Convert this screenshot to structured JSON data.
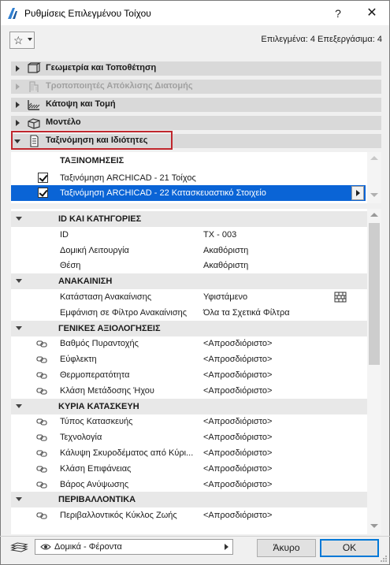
{
  "window": {
    "title": "Ρυθμίσεις Επιλεγμένου Τοίχου",
    "help": "?",
    "close": "✕"
  },
  "header": {
    "selection_info": "Επιλεγμένα: 4 Επεξεργάσιμα: 4"
  },
  "panels": [
    {
      "label": "Γεωμετρία και Τοποθέτηση",
      "enabled": true,
      "expanded": false,
      "icon": "geometry-icon"
    },
    {
      "label": "Τροποποιητές Απόκλισης Διατομής",
      "enabled": false,
      "expanded": false,
      "icon": "profile-modifier-icon"
    },
    {
      "label": "Κάτοψη και Τομή",
      "enabled": true,
      "expanded": false,
      "icon": "floor-plan-icon"
    },
    {
      "label": "Μοντέλο",
      "enabled": true,
      "expanded": false,
      "icon": "model-box-icon"
    },
    {
      "label": "Ταξινόμηση και Ιδιότητες",
      "enabled": true,
      "expanded": true,
      "icon": "document-icon"
    }
  ],
  "classifications": {
    "header": "ΤΑΞΙΝΟΜΗΣΕΙΣ",
    "items": [
      {
        "label": "Ταξινόμηση ARCHICAD - 21 Τοίχος",
        "checked": true,
        "selected": false
      },
      {
        "label": "Ταξινόμηση ARCHICAD - 22 Κατασκευαστικό Στοιχείο",
        "checked": true,
        "selected": true
      }
    ]
  },
  "properties": {
    "groups": [
      {
        "name": "ID ΚΑΙ ΚΑΤΗΓΟΡΙΕΣ",
        "rows": [
          {
            "name": "ID",
            "value": "ΤΧ - 003",
            "linked": false
          },
          {
            "name": "Δομική Λειτουργία",
            "value": "Ακαθόριστη",
            "linked": false
          },
          {
            "name": "Θέση",
            "value": "Ακαθόριστη",
            "linked": false
          }
        ]
      },
      {
        "name": "ΑΝΑΚΑΙΝΙΣΗ",
        "rows": [
          {
            "name": "Κατάσταση Ανακαίνισης",
            "value": "Υφιστάμενο",
            "linked": false,
            "icon": "brick-wall-icon"
          },
          {
            "name": "Εμφάνιση σε Φίλτρο Ανακαίνισης",
            "value": "Όλα τα Σχετικά Φίλτρα",
            "linked": false
          }
        ]
      },
      {
        "name": "ΓΕΝΙΚΕΣ ΑΞΙΟΛΟΓΗΣΕΙΣ",
        "rows": [
          {
            "name": "Βαθμός Πυραντοχής",
            "value": "<Απροσδιόριστο>",
            "linked": true
          },
          {
            "name": "Εύφλεκτη",
            "value": "<Απροσδιόριστο>",
            "linked": true
          },
          {
            "name": "Θερμοπερατότητα",
            "value": "<Απροσδιόριστο>",
            "linked": true
          },
          {
            "name": "Κλάση Μετάδοσης Ήχου",
            "value": "<Απροσδιόριστο>",
            "linked": true
          }
        ]
      },
      {
        "name": "ΚΥΡΙΑ ΚΑΤΑΣΚΕΥΗ",
        "rows": [
          {
            "name": "Τύπος Κατασκευής",
            "value": "<Απροσδιόριστο>",
            "linked": true
          },
          {
            "name": "Τεχνολογία",
            "value": "<Απροσδιόριστο>",
            "linked": true
          },
          {
            "name": "Κάλυψη Σκυροδέματος από Κύρι...",
            "value": "<Απροσδιόριστο>",
            "linked": true
          },
          {
            "name": "Κλάση Επιφάνειας",
            "value": "<Απροσδιόριστο>",
            "linked": true
          },
          {
            "name": "Βάρος Ανύψωσης",
            "value": "<Απροσδιόριστο>",
            "linked": true
          }
        ]
      },
      {
        "name": "ΠΕΡΙΒΑΛΛΟΝΤΙΚΑ",
        "rows": [
          {
            "name": "Περιβαλλοντικός Κύκλος Ζωής",
            "value": "<Απροσδιόριστο>",
            "linked": true
          }
        ]
      }
    ]
  },
  "footer": {
    "layer_value": "Δομικά - Φέροντα",
    "cancel_label": "Άκυρο",
    "ok_label": "OK"
  },
  "colors": {
    "selection": "#0a64d6",
    "highlight_box": "#c0272d",
    "panel_header": "#d9d9d9",
    "group_row": "#e8e8e8"
  }
}
